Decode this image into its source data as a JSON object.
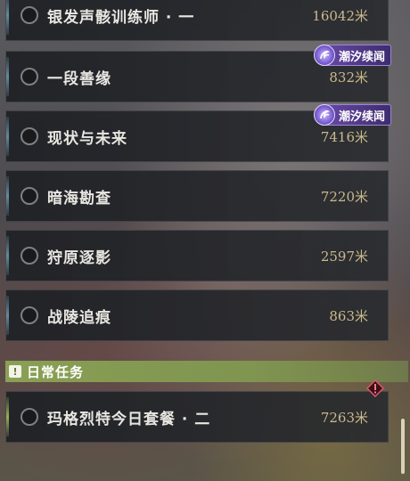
{
  "quests": [
    {
      "name": "银发声骸训练师 · 一",
      "distance": "16042米"
    },
    {
      "name": "一段善缘",
      "distance": "832米",
      "badge": "潮汐续闻"
    },
    {
      "name": "现状与未来",
      "distance": "7416米",
      "badge": "潮汐续闻"
    },
    {
      "name": "暗海勘查",
      "distance": "7220米"
    },
    {
      "name": "狩原逐影",
      "distance": "2597米"
    },
    {
      "name": "战陵追痕",
      "distance": "863米"
    }
  ],
  "daily_section": {
    "title": "日常任务",
    "icon": "exclamation-box-icon",
    "quests": [
      {
        "name": "玛格烈特今日套餐 · 二",
        "distance": "7263米",
        "alert_icon": "warning-diamond-icon"
      }
    ]
  },
  "colors": {
    "badge": "#6a4aa8",
    "daily_accent": "#8ca555",
    "distance_text": "#c9b98c"
  }
}
